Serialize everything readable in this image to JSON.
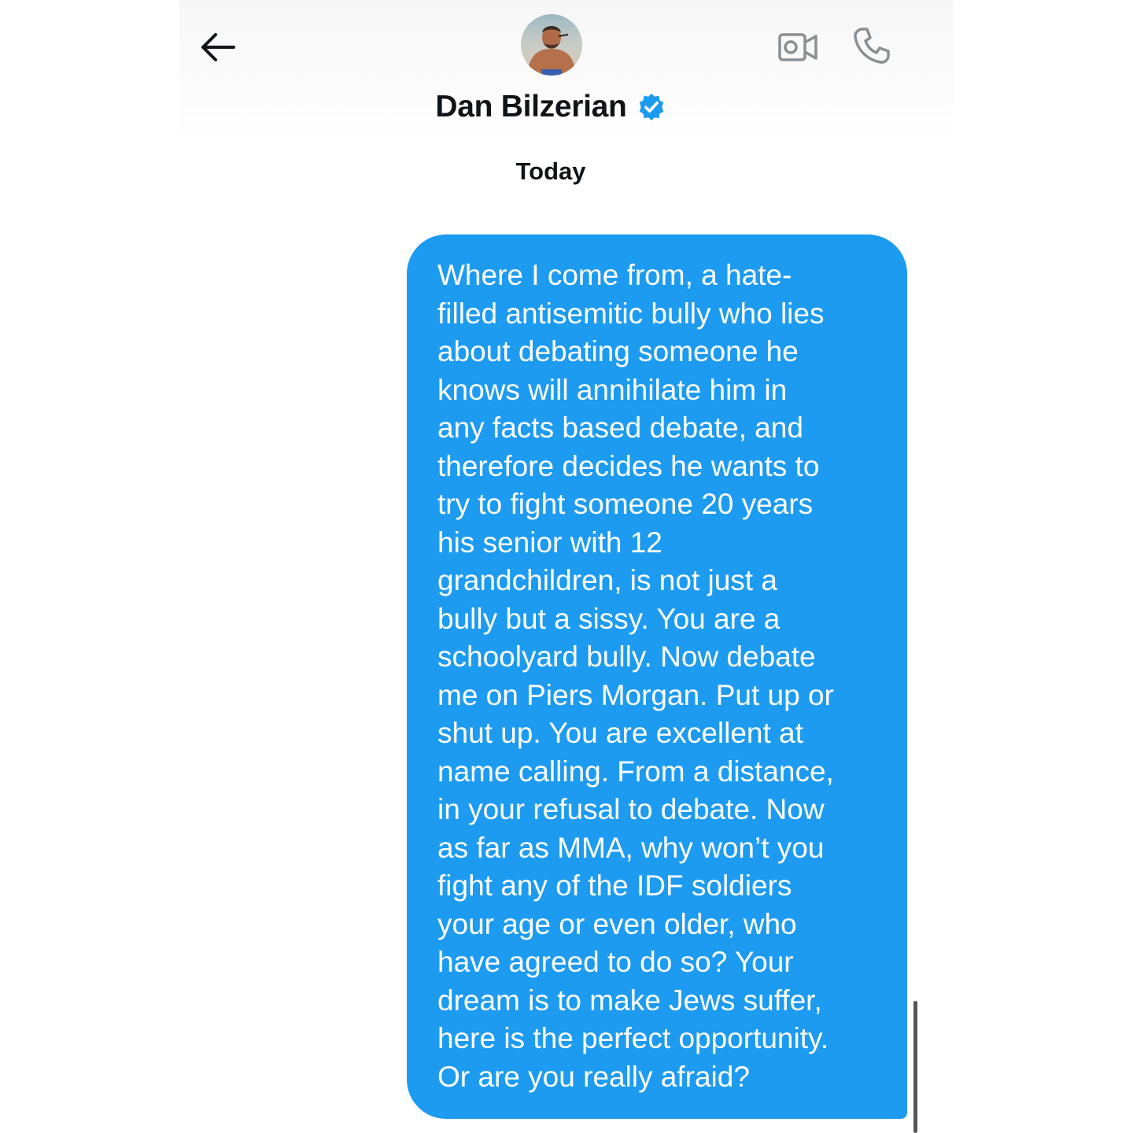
{
  "header": {
    "back_icon": "arrow-left-icon",
    "contact_name": "Dan Bilzerian",
    "verified_icon": "verified-badge-icon",
    "video_icon": "video-camera-icon",
    "call_icon": "phone-icon",
    "accent_color": "#1d9bf0"
  },
  "conversation": {
    "day_label": "Today",
    "messages": [
      {
        "direction": "outgoing",
        "text": "Where I come from, a hate-\nfilled antisemitic bully who lies\nabout debating someone he\nknows will annihilate him in\nany facts based debate, and\ntherefore decides he wants to\ntry to fight someone 20 years\nhis senior with 12\ngrandchildren, is not just a\nbully but a sissy. You are a\nschoolyard bully. Now debate\nme on Piers Morgan. Put up or\nshut up. You are excellent at\nname calling. From a distance,\nin your refusal to debate. Now\nas far as MMA, why won’t you\nfight any of the IDF soldiers\nyour age or even older, who\nhave agreed to do so? Your\ndream is to make Jews suffer,\nhere is the perfect opportunity.\nOr are you really afraid?",
        "bubble_color": "#1d9bf0"
      }
    ]
  }
}
